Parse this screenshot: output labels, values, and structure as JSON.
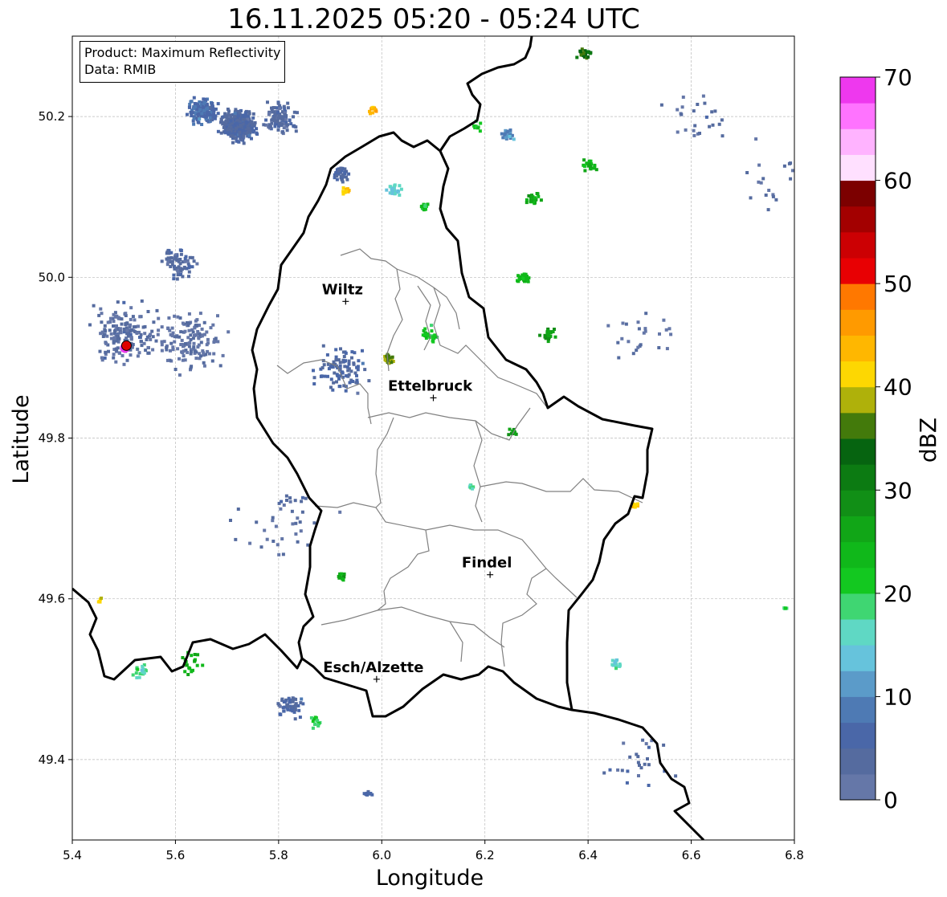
{
  "title": "16.11.2025 05:20 - 05:24 UTC",
  "info": {
    "product": "Product: Maximum Reflectivity",
    "data": "Data: RMIB"
  },
  "axes": {
    "xlabel": "Longitude",
    "ylabel": "Latitude",
    "xlim": [
      5.4,
      6.8
    ],
    "ylim": [
      49.3,
      50.3
    ],
    "xticks": [
      "5.4",
      "5.6",
      "5.8",
      "6.0",
      "6.2",
      "6.4",
      "6.6",
      "6.8"
    ],
    "yticks": [
      "49.4",
      "49.6",
      "49.8",
      "50.0",
      "50.2"
    ],
    "grid": true
  },
  "cities": [
    {
      "name": "Wiltz",
      "lon": 5.93,
      "lat": 49.97
    },
    {
      "name": "Ettelbruck",
      "lon": 6.1,
      "lat": 49.85
    },
    {
      "name": "Findel",
      "lon": 6.21,
      "lat": 49.63
    },
    {
      "name": "Esch/Alzette",
      "lon": 5.99,
      "lat": 49.5
    }
  ],
  "radar_site": {
    "lon": 5.505,
    "lat": 49.915
  },
  "colorbar": {
    "label": "dBZ",
    "ticks": [
      "0",
      "10",
      "20",
      "30",
      "40",
      "50",
      "60",
      "70"
    ],
    "range": [
      0,
      70
    ],
    "colors": [
      "#6577a8",
      "#556b9f",
      "#4a67a8",
      "#4e7ab4",
      "#5b9bc9",
      "#66c3dc",
      "#5fd8c4",
      "#3fd672",
      "#13c820",
      "#10b81a",
      "#11a617",
      "#118f16",
      "#0c7b12",
      "#066410",
      "#437a0b",
      "#afb10a",
      "#fdd702",
      "#ffb700",
      "#ff9a00",
      "#ff7800",
      "#e80003",
      "#cc0003",
      "#a30000",
      "#7c0000",
      "#ffe0ff",
      "#ffb3ff",
      "#ff73ff",
      "#ee38ee"
    ]
  },
  "echoes": [
    {
      "lon": 5.72,
      "lat": 50.19,
      "dbz": 5,
      "n": 420,
      "s": 0.035
    },
    {
      "lon": 5.65,
      "lat": 50.21,
      "dbz": 7,
      "n": 160,
      "s": 0.03
    },
    {
      "lon": 5.8,
      "lat": 50.2,
      "dbz": 4,
      "n": 120,
      "s": 0.035
    },
    {
      "lon": 5.5,
      "lat": 49.93,
      "dbz": 3,
      "n": 180,
      "s": 0.07
    },
    {
      "lon": 5.63,
      "lat": 49.92,
      "dbz": 2,
      "n": 140,
      "s": 0.07
    },
    {
      "lon": 5.6,
      "lat": 50.02,
      "dbz": 4,
      "n": 70,
      "s": 0.04
    },
    {
      "lon": 5.92,
      "lat": 50.13,
      "dbz": 5,
      "n": 35,
      "s": 0.02
    },
    {
      "lon": 5.93,
      "lat": 50.11,
      "dbz": 42,
      "n": 12,
      "s": 0.01
    },
    {
      "lon": 5.98,
      "lat": 50.21,
      "dbz": 44,
      "n": 12,
      "s": 0.01
    },
    {
      "lon": 6.02,
      "lat": 50.11,
      "dbz": 15,
      "n": 30,
      "s": 0.015
    },
    {
      "lon": 6.08,
      "lat": 50.09,
      "dbz": 22,
      "n": 15,
      "s": 0.01
    },
    {
      "lon": 6.09,
      "lat": 49.93,
      "dbz": 21,
      "n": 25,
      "s": 0.02
    },
    {
      "lon": 6.01,
      "lat": 49.9,
      "dbz": 38,
      "n": 25,
      "s": 0.012
    },
    {
      "lon": 5.92,
      "lat": 49.89,
      "dbz": 5,
      "n": 90,
      "s": 0.06
    },
    {
      "lon": 6.24,
      "lat": 50.18,
      "dbz": 10,
      "n": 20,
      "s": 0.015
    },
    {
      "lon": 6.18,
      "lat": 50.19,
      "dbz": 22,
      "n": 10,
      "s": 0.01
    },
    {
      "lon": 6.29,
      "lat": 50.1,
      "dbz": 26,
      "n": 25,
      "s": 0.015
    },
    {
      "lon": 6.4,
      "lat": 50.14,
      "dbz": 24,
      "n": 20,
      "s": 0.015
    },
    {
      "lon": 6.27,
      "lat": 50.0,
      "dbz": 24,
      "n": 30,
      "s": 0.015
    },
    {
      "lon": 6.32,
      "lat": 49.93,
      "dbz": 28,
      "n": 25,
      "s": 0.015
    },
    {
      "lon": 6.39,
      "lat": 50.28,
      "dbz": 34,
      "n": 20,
      "s": 0.015
    },
    {
      "lon": 6.25,
      "lat": 49.81,
      "dbz": 28,
      "n": 12,
      "s": 0.01
    },
    {
      "lon": 6.45,
      "lat": 49.52,
      "dbz": 16,
      "n": 15,
      "s": 0.012
    },
    {
      "lon": 6.49,
      "lat": 49.72,
      "dbz": 42,
      "n": 10,
      "s": 0.01
    },
    {
      "lon": 5.92,
      "lat": 49.63,
      "dbz": 26,
      "n": 12,
      "s": 0.01
    },
    {
      "lon": 5.63,
      "lat": 49.52,
      "dbz": 24,
      "n": 20,
      "s": 0.025
    },
    {
      "lon": 5.53,
      "lat": 49.51,
      "dbz": 18,
      "n": 20,
      "s": 0.02
    },
    {
      "lon": 5.82,
      "lat": 49.47,
      "dbz": 5,
      "n": 50,
      "s": 0.03
    },
    {
      "lon": 5.87,
      "lat": 49.45,
      "dbz": 20,
      "n": 15,
      "s": 0.015
    },
    {
      "lon": 6.17,
      "lat": 49.74,
      "dbz": 18,
      "n": 8,
      "s": 0.008
    },
    {
      "lon": 5.45,
      "lat": 49.6,
      "dbz": 42,
      "n": 5,
      "s": 0.006
    },
    {
      "lon": 6.78,
      "lat": 49.59,
      "dbz": 20,
      "n": 5,
      "s": 0.006
    },
    {
      "lon": 6.6,
      "lat": 50.2,
      "dbz": 3,
      "n": 25,
      "s": 0.08
    },
    {
      "lon": 6.75,
      "lat": 50.12,
      "dbz": 3,
      "n": 20,
      "s": 0.08
    },
    {
      "lon": 5.8,
      "lat": 49.7,
      "dbz": 3,
      "n": 40,
      "s": 0.1
    },
    {
      "lon": 6.5,
      "lat": 49.4,
      "dbz": 4,
      "n": 25,
      "s": 0.07
    },
    {
      "lon": 6.5,
      "lat": 49.93,
      "dbz": 3,
      "n": 25,
      "s": 0.08
    },
    {
      "lon": 5.97,
      "lat": 49.36,
      "dbz": 6,
      "n": 10,
      "s": 0.01
    }
  ]
}
